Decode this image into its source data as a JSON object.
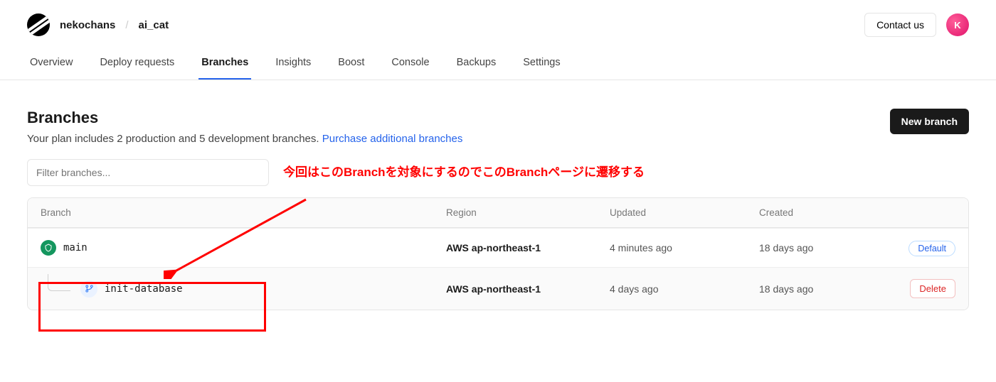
{
  "breadcrumb": {
    "org": "nekochans",
    "repo": "ai_cat"
  },
  "header": {
    "contact": "Contact us",
    "avatar_initial": "K"
  },
  "nav": {
    "items": [
      "Overview",
      "Deploy requests",
      "Branches",
      "Insights",
      "Boost",
      "Console",
      "Backups",
      "Settings"
    ],
    "active": "Branches"
  },
  "page": {
    "title": "Branches",
    "subtitle_prefix": "Your plan includes 2 production and 5 development branches. ",
    "subtitle_link": "Purchase additional branches",
    "new_branch": "New branch"
  },
  "filter": {
    "placeholder": "Filter branches..."
  },
  "annotation": {
    "text": "今回はこのBranchを対象にするのでこのBranchページに遷移する"
  },
  "columns": {
    "branch": "Branch",
    "region": "Region",
    "updated": "Updated",
    "created": "Created"
  },
  "rows": [
    {
      "name": "main",
      "region": "AWS ap-northeast-1",
      "updated": "4 minutes ago",
      "created": "18 days ago",
      "badge": "Default",
      "protected": true,
      "child": false
    },
    {
      "name": "init-database",
      "region": "AWS ap-northeast-1",
      "updated": "4 days ago",
      "created": "18 days ago",
      "delete": "Delete",
      "protected": false,
      "child": true
    }
  ]
}
